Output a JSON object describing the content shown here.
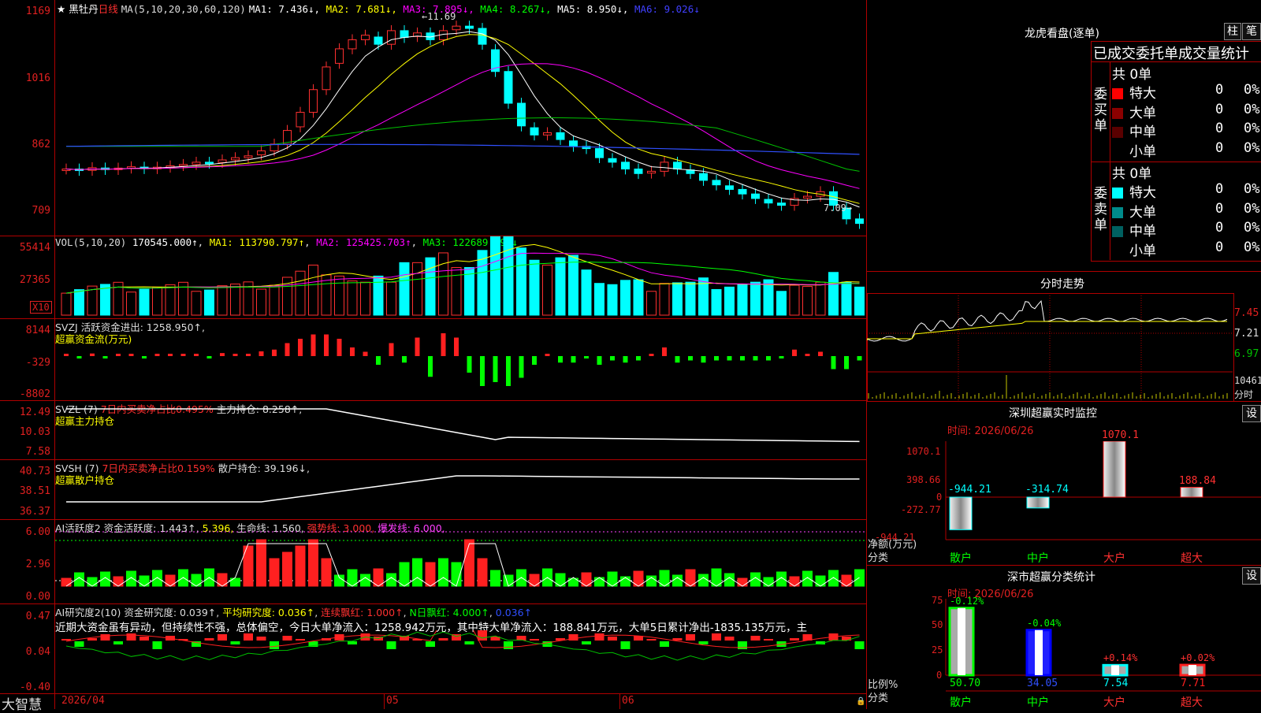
{
  "main": {
    "stock_name": "黑牡丹",
    "period": "日线",
    "ma_label": "MA(5,10,20,30,60,120)",
    "ma": [
      {
        "name": "MA1:",
        "value": "7.436↓",
        "color": "#ffffff"
      },
      {
        "name": "MA2:",
        "value": "7.681↓",
        "color": "#ffff00"
      },
      {
        "name": "MA3:",
        "value": "7.895↓",
        "color": "#ff00ff"
      },
      {
        "name": "MA4:",
        "value": "8.267↓",
        "color": "#00ff00"
      },
      {
        "name": "MA5:",
        "value": "8.950↓",
        "color": "#ffffff"
      },
      {
        "name": "MA6:",
        "value": "9.026↓",
        "color": "#4040ff"
      }
    ],
    "y_ticks": [
      "1169",
      "1016",
      "862",
      "709"
    ],
    "high_marker": "11.69",
    "low_marker": "7.09"
  },
  "vol": {
    "title": "VOL(5,10,20)",
    "value": "170545.000↑",
    "ma1": "MA1: 113790.797↑",
    "ma2": "MA2: 125425.703↑",
    "ma3": "MA3: 122689.297↓",
    "y_ticks": [
      "55414",
      "27365"
    ],
    "unit": "X10"
  },
  "svzj": {
    "title": "SVZJ  活跃资金进出: 1258.950↑,",
    "subtitle": "超赢资金流(万元)",
    "y_ticks": [
      "8144",
      "-329",
      "-8802"
    ]
  },
  "svzl": {
    "title_a": "SVZL (7)",
    "title_b": "7日内买卖净占比0.495%",
    "title_c": "主力持仓: 8.258↑,",
    "subtitle": "超赢主力持仓",
    "y_ticks": [
      "12.49",
      "10.03",
      "7.58"
    ]
  },
  "svsh": {
    "title_a": "SVSH (7)",
    "title_b": "7日内买卖净占比0.159%",
    "title_c": "散户持仓: 39.196↓,",
    "subtitle": "超赢散户持仓",
    "y_ticks": [
      "40.73",
      "38.51",
      "36.37"
    ]
  },
  "ai1": {
    "t1": "AI活跃度2 资金活跃度: 1.443↑",
    "t2": "5.396,",
    "t3": "生命线: 1.560,",
    "t4": "强势线: 3.000,",
    "t5": "爆发线: 6.000,",
    "y_ticks": [
      "6.00",
      "2.96",
      "0.00"
    ]
  },
  "ai2": {
    "t1": "AI研究度2(10) 资金研究度: 0.039↑",
    "t2": "平均研究度: 0.036↑",
    "t3": "连续飘红: 1.000↑",
    "t4": "N日飘红: 4.000↑",
    "t5": "0.036↑",
    "commentary": "近期大资金虽有异动，但持续性不强，总体偏空，今日大单净流入：1258.942万元，其中特大单净流入：188.841万元，大单5日累计净出-1835.135万元，主",
    "y_ticks": [
      "0.47",
      "0.04",
      "-0.40"
    ]
  },
  "xaxis": {
    "brand": "大智慧",
    "date": "2026/04",
    "m1": "05",
    "m2": "06"
  },
  "right": {
    "lhkp": {
      "title": "龙虎看盘(逐单)",
      "btn1": "柱",
      "btn2": "笔"
    },
    "stats": {
      "header": "已成交委托单成交量统计",
      "buy": {
        "side": "委买单",
        "count": "共 0单",
        "rows": [
          {
            "label": "特大",
            "n": "0",
            "p": "0%",
            "color": "#ff0000"
          },
          {
            "label": "大单",
            "n": "0",
            "p": "0%",
            "color": "#8b0000"
          },
          {
            "label": "中单",
            "n": "0",
            "p": "0%",
            "color": "#5a0000"
          },
          {
            "label": "小单",
            "n": "0",
            "p": "0%",
            "color": ""
          }
        ]
      },
      "sell": {
        "side": "委卖单",
        "count": "共 0单",
        "rows": [
          {
            "label": "特大",
            "n": "0",
            "p": "0%",
            "color": "#00ffff"
          },
          {
            "label": "大单",
            "n": "0",
            "p": "0%",
            "color": "#008b8b"
          },
          {
            "label": "中单",
            "n": "0",
            "p": "0%",
            "color": "#006060"
          },
          {
            "label": "小单",
            "n": "0",
            "p": "0%",
            "color": ""
          }
        ]
      }
    },
    "intraday": {
      "title": "分时走势",
      "ticks": [
        "7.45",
        "7.21",
        "6.97"
      ],
      "vol": "10461",
      "vol_unit": "分时"
    },
    "sz": {
      "title": "深圳超赢实时监控",
      "btn": "设",
      "time": "时间: 2026/06/26",
      "y_ticks": [
        "1070.1",
        "398.66",
        "0",
        "-272.77",
        "-944.21"
      ],
      "ylabel1": "净额(万元)",
      "ylabel2": "分类",
      "cats": [
        "散户",
        "中户",
        "大户",
        "超大"
      ],
      "vals": [
        "-944.21",
        "-314.74",
        "1070.1",
        "188.84"
      ]
    },
    "sc": {
      "title": "深市超赢分类统计",
      "btn": "设",
      "time": "时间: 2026/06/26",
      "y_ticks": [
        "75",
        "50",
        "25",
        "0"
      ],
      "ylabel1": "比例%",
      "ylabel2": "分类",
      "cats": [
        "散户",
        "中户",
        "大户",
        "超大"
      ],
      "top": [
        "-0.12%",
        "-0.04%",
        "+0.14%",
        "+0.02%"
      ],
      "bottom": [
        "50.70",
        "34.05",
        "7.54",
        "7.71"
      ]
    }
  },
  "chart_data": [
    {
      "type": "candlestick",
      "title": "黑牡丹 日线",
      "ylim": [
        7.09,
        11.69
      ],
      "high": 11.69,
      "low": 7.09
    },
    {
      "type": "bar",
      "title": "深圳超赢实时监控",
      "categories": [
        "散户",
        "中户",
        "大户",
        "超大"
      ],
      "values": [
        -944.21,
        -314.74,
        1070.1,
        188.84
      ],
      "ylabel": "净额(万元)"
    },
    {
      "type": "bar",
      "title": "深市超赢分类统计",
      "categories": [
        "散户",
        "中户",
        "大户",
        "超大"
      ],
      "values": [
        50.7,
        34.05,
        7.54,
        7.71
      ],
      "change": [
        "-0.12%",
        "-0.04%",
        "+0.14%",
        "+0.02%"
      ],
      "ylabel": "比例%",
      "ylim": [
        0,
        75
      ]
    }
  ]
}
